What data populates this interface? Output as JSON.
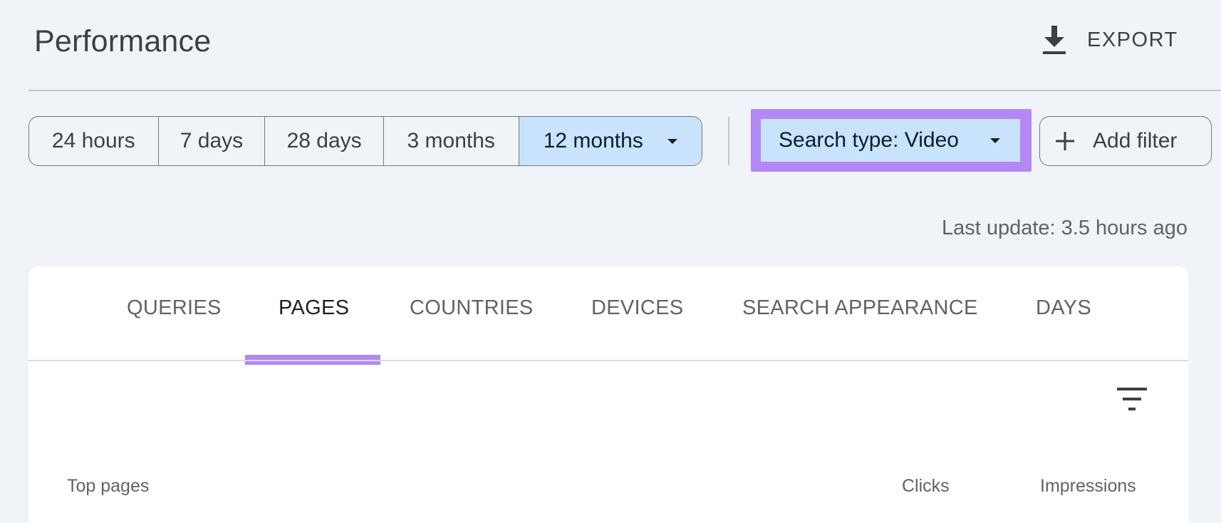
{
  "header": {
    "title": "Performance",
    "export_label": "EXPORT"
  },
  "date_range": {
    "options": [
      "24 hours",
      "7 days",
      "28 days",
      "3 months",
      "12 months"
    ],
    "selected": "12 months"
  },
  "filters": {
    "search_type": "Search type: Video",
    "add_filter_label": "Add filter"
  },
  "last_update": "Last update: 3.5 hours ago",
  "tabs": [
    {
      "label": "QUERIES",
      "active": false
    },
    {
      "label": "PAGES",
      "active": true
    },
    {
      "label": "COUNTRIES",
      "active": false
    },
    {
      "label": "DEVICES",
      "active": false
    },
    {
      "label": "SEARCH APPEARANCE",
      "active": false
    },
    {
      "label": "DAYS",
      "active": false
    }
  ],
  "table": {
    "columns": [
      "Top pages",
      "Clicks",
      "Impressions"
    ]
  },
  "colors": {
    "highlight": "#b388f5",
    "selected_bg": "#c8e3fb",
    "page_bg": "#f0f4f9"
  },
  "icons": {
    "export": "download-icon",
    "add_filter": "plus-icon",
    "table_filter": "filter-list-icon"
  }
}
